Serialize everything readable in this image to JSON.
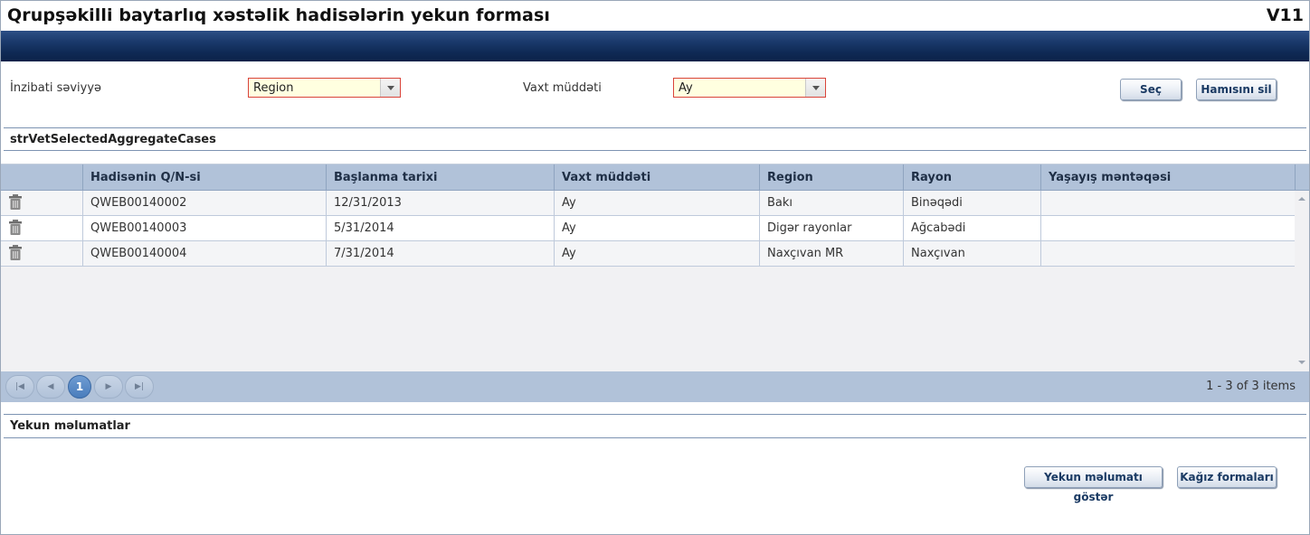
{
  "window": {
    "title": "Qrupşəkilli baytarlıq xəstəlik hadisələrin yekun forması",
    "version": "V11"
  },
  "filters": {
    "admin_level_label": "İnzibati səviyyə",
    "admin_level_value": "Region",
    "time_period_label": "Vaxt müddəti",
    "time_period_value": "Ay"
  },
  "buttons": {
    "select": "Seç",
    "clear_all": "Hamısını sil",
    "show_summary": "Yekun məlumatı göstər",
    "paper_forms": "Kağız formaları"
  },
  "sections": {
    "selected_cases": "strVetSelectedAggregateCases",
    "summary": "Yekun məlumatlar"
  },
  "grid": {
    "columns": [
      "Hadisənin Q/N-si",
      "Başlanma tarixi",
      "Vaxt müddəti",
      "Region",
      "Rayon",
      "Yaşayış məntəqəsi"
    ],
    "rows": [
      {
        "case_no": "QWEB00140002",
        "start_date": "12/31/2013",
        "period": "Ay",
        "region": "Bakı",
        "rayon": "Binəqədi",
        "settlement": ""
      },
      {
        "case_no": "QWEB00140003",
        "start_date": "5/31/2014",
        "period": "Ay",
        "region": "Digər rayonlar",
        "rayon": "Ağcabədi",
        "settlement": ""
      },
      {
        "case_no": "QWEB00140004",
        "start_date": "7/31/2014",
        "period": "Ay",
        "region": "Naxçıvan MR",
        "rayon": "Naxçıvan",
        "settlement": ""
      }
    ]
  },
  "pager": {
    "current_page": "1",
    "info": "1 - 3 of 3 items"
  },
  "icons": {
    "delete": "trash-icon",
    "first": "first-page-icon",
    "prev": "prev-page-icon",
    "next": "next-page-icon",
    "last": "last-page-icon"
  },
  "colors": {
    "banner": "#1b3a6c",
    "grid_header": "#b1c2d9",
    "combo_border": "#d9443a",
    "combo_bg": "#ffffe0"
  }
}
